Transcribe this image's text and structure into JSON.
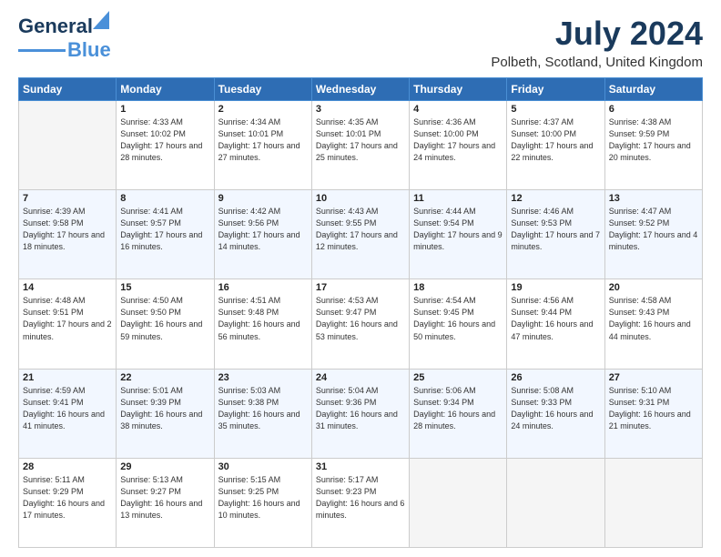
{
  "logo": {
    "line1": "General",
    "line2": "Blue"
  },
  "title": "July 2024",
  "location": "Polbeth, Scotland, United Kingdom",
  "days_of_week": [
    "Sunday",
    "Monday",
    "Tuesday",
    "Wednesday",
    "Thursday",
    "Friday",
    "Saturday"
  ],
  "weeks": [
    [
      {
        "day": "",
        "sunrise": "",
        "sunset": "",
        "daylight": ""
      },
      {
        "day": "1",
        "sunrise": "Sunrise: 4:33 AM",
        "sunset": "Sunset: 10:02 PM",
        "daylight": "Daylight: 17 hours and 28 minutes."
      },
      {
        "day": "2",
        "sunrise": "Sunrise: 4:34 AM",
        "sunset": "Sunset: 10:01 PM",
        "daylight": "Daylight: 17 hours and 27 minutes."
      },
      {
        "day": "3",
        "sunrise": "Sunrise: 4:35 AM",
        "sunset": "Sunset: 10:01 PM",
        "daylight": "Daylight: 17 hours and 25 minutes."
      },
      {
        "day": "4",
        "sunrise": "Sunrise: 4:36 AM",
        "sunset": "Sunset: 10:00 PM",
        "daylight": "Daylight: 17 hours and 24 minutes."
      },
      {
        "day": "5",
        "sunrise": "Sunrise: 4:37 AM",
        "sunset": "Sunset: 10:00 PM",
        "daylight": "Daylight: 17 hours and 22 minutes."
      },
      {
        "day": "6",
        "sunrise": "Sunrise: 4:38 AM",
        "sunset": "Sunset: 9:59 PM",
        "daylight": "Daylight: 17 hours and 20 minutes."
      }
    ],
    [
      {
        "day": "7",
        "sunrise": "Sunrise: 4:39 AM",
        "sunset": "Sunset: 9:58 PM",
        "daylight": "Daylight: 17 hours and 18 minutes."
      },
      {
        "day": "8",
        "sunrise": "Sunrise: 4:41 AM",
        "sunset": "Sunset: 9:57 PM",
        "daylight": "Daylight: 17 hours and 16 minutes."
      },
      {
        "day": "9",
        "sunrise": "Sunrise: 4:42 AM",
        "sunset": "Sunset: 9:56 PM",
        "daylight": "Daylight: 17 hours and 14 minutes."
      },
      {
        "day": "10",
        "sunrise": "Sunrise: 4:43 AM",
        "sunset": "Sunset: 9:55 PM",
        "daylight": "Daylight: 17 hours and 12 minutes."
      },
      {
        "day": "11",
        "sunrise": "Sunrise: 4:44 AM",
        "sunset": "Sunset: 9:54 PM",
        "daylight": "Daylight: 17 hours and 9 minutes."
      },
      {
        "day": "12",
        "sunrise": "Sunrise: 4:46 AM",
        "sunset": "Sunset: 9:53 PM",
        "daylight": "Daylight: 17 hours and 7 minutes."
      },
      {
        "day": "13",
        "sunrise": "Sunrise: 4:47 AM",
        "sunset": "Sunset: 9:52 PM",
        "daylight": "Daylight: 17 hours and 4 minutes."
      }
    ],
    [
      {
        "day": "14",
        "sunrise": "Sunrise: 4:48 AM",
        "sunset": "Sunset: 9:51 PM",
        "daylight": "Daylight: 17 hours and 2 minutes."
      },
      {
        "day": "15",
        "sunrise": "Sunrise: 4:50 AM",
        "sunset": "Sunset: 9:50 PM",
        "daylight": "Daylight: 16 hours and 59 minutes."
      },
      {
        "day": "16",
        "sunrise": "Sunrise: 4:51 AM",
        "sunset": "Sunset: 9:48 PM",
        "daylight": "Daylight: 16 hours and 56 minutes."
      },
      {
        "day": "17",
        "sunrise": "Sunrise: 4:53 AM",
        "sunset": "Sunset: 9:47 PM",
        "daylight": "Daylight: 16 hours and 53 minutes."
      },
      {
        "day": "18",
        "sunrise": "Sunrise: 4:54 AM",
        "sunset": "Sunset: 9:45 PM",
        "daylight": "Daylight: 16 hours and 50 minutes."
      },
      {
        "day": "19",
        "sunrise": "Sunrise: 4:56 AM",
        "sunset": "Sunset: 9:44 PM",
        "daylight": "Daylight: 16 hours and 47 minutes."
      },
      {
        "day": "20",
        "sunrise": "Sunrise: 4:58 AM",
        "sunset": "Sunset: 9:43 PM",
        "daylight": "Daylight: 16 hours and 44 minutes."
      }
    ],
    [
      {
        "day": "21",
        "sunrise": "Sunrise: 4:59 AM",
        "sunset": "Sunset: 9:41 PM",
        "daylight": "Daylight: 16 hours and 41 minutes."
      },
      {
        "day": "22",
        "sunrise": "Sunrise: 5:01 AM",
        "sunset": "Sunset: 9:39 PM",
        "daylight": "Daylight: 16 hours and 38 minutes."
      },
      {
        "day": "23",
        "sunrise": "Sunrise: 5:03 AM",
        "sunset": "Sunset: 9:38 PM",
        "daylight": "Daylight: 16 hours and 35 minutes."
      },
      {
        "day": "24",
        "sunrise": "Sunrise: 5:04 AM",
        "sunset": "Sunset: 9:36 PM",
        "daylight": "Daylight: 16 hours and 31 minutes."
      },
      {
        "day": "25",
        "sunrise": "Sunrise: 5:06 AM",
        "sunset": "Sunset: 9:34 PM",
        "daylight": "Daylight: 16 hours and 28 minutes."
      },
      {
        "day": "26",
        "sunrise": "Sunrise: 5:08 AM",
        "sunset": "Sunset: 9:33 PM",
        "daylight": "Daylight: 16 hours and 24 minutes."
      },
      {
        "day": "27",
        "sunrise": "Sunrise: 5:10 AM",
        "sunset": "Sunset: 9:31 PM",
        "daylight": "Daylight: 16 hours and 21 minutes."
      }
    ],
    [
      {
        "day": "28",
        "sunrise": "Sunrise: 5:11 AM",
        "sunset": "Sunset: 9:29 PM",
        "daylight": "Daylight: 16 hours and 17 minutes."
      },
      {
        "day": "29",
        "sunrise": "Sunrise: 5:13 AM",
        "sunset": "Sunset: 9:27 PM",
        "daylight": "Daylight: 16 hours and 13 minutes."
      },
      {
        "day": "30",
        "sunrise": "Sunrise: 5:15 AM",
        "sunset": "Sunset: 9:25 PM",
        "daylight": "Daylight: 16 hours and 10 minutes."
      },
      {
        "day": "31",
        "sunrise": "Sunrise: 5:17 AM",
        "sunset": "Sunset: 9:23 PM",
        "daylight": "Daylight: 16 hours and 6 minutes."
      },
      {
        "day": "",
        "sunrise": "",
        "sunset": "",
        "daylight": ""
      },
      {
        "day": "",
        "sunrise": "",
        "sunset": "",
        "daylight": ""
      },
      {
        "day": "",
        "sunrise": "",
        "sunset": "",
        "daylight": ""
      }
    ]
  ]
}
